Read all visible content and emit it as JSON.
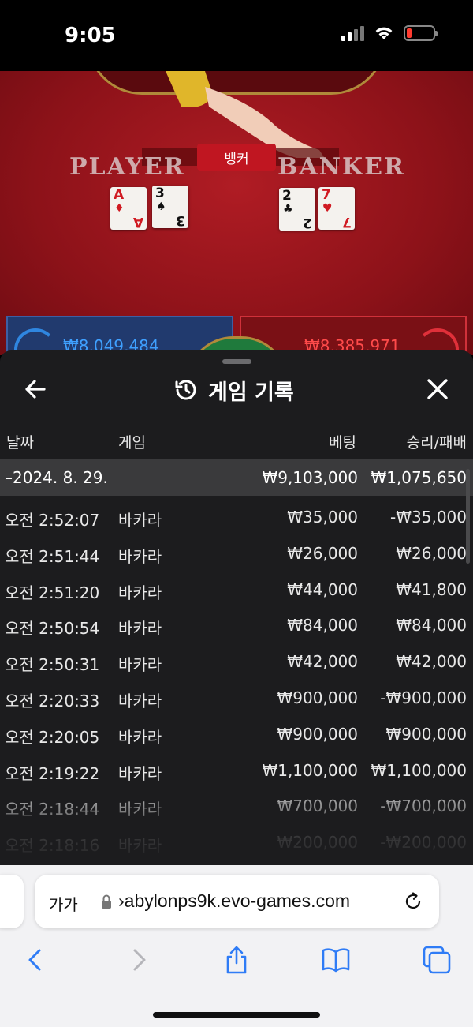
{
  "status_bar": {
    "time": "9:05"
  },
  "game": {
    "banner": "뱅커",
    "player_label": "PLAYER",
    "banker_label": "BANKER",
    "player_cards": [
      {
        "rank": "A",
        "suit": "♦",
        "color": "red"
      },
      {
        "rank": "3",
        "suit": "♠",
        "color": "black"
      }
    ],
    "banker_cards": [
      {
        "rank": "2",
        "suit": "♣",
        "color": "black"
      },
      {
        "rank": "7",
        "suit": "♥",
        "color": "red"
      }
    ],
    "player_total": "₩8,049,484",
    "banker_total": "₩8,385,971"
  },
  "history": {
    "title": "게임 기록",
    "columns": {
      "date": "날짜",
      "game": "게임",
      "bet": "베팅",
      "result": "승리/패배"
    },
    "date_group": {
      "date": "–2024. 8. 29.",
      "bet_total": "₩9,103,000",
      "result_total": "₩1,075,650"
    },
    "rows": [
      {
        "time": "오전 2:52:07",
        "game": "바카라",
        "bet": "₩35,000",
        "result": "-₩35,000"
      },
      {
        "time": "오전 2:51:44",
        "game": "바카라",
        "bet": "₩26,000",
        "result": "₩26,000"
      },
      {
        "time": "오전 2:51:20",
        "game": "바카라",
        "bet": "₩44,000",
        "result": "₩41,800"
      },
      {
        "time": "오전 2:50:54",
        "game": "바카라",
        "bet": "₩84,000",
        "result": "₩84,000"
      },
      {
        "time": "오전 2:50:31",
        "game": "바카라",
        "bet": "₩42,000",
        "result": "₩42,000"
      },
      {
        "time": "오전 2:20:33",
        "game": "바카라",
        "bet": "₩900,000",
        "result": "-₩900,000"
      },
      {
        "time": "오전 2:20:05",
        "game": "바카라",
        "bet": "₩900,000",
        "result": "₩900,000"
      },
      {
        "time": "오전 2:19:22",
        "game": "바카라",
        "bet": "₩1,100,000",
        "result": "₩1,100,000"
      },
      {
        "time": "오전 2:18:44",
        "game": "바카라",
        "bet": "₩700,000",
        "result": "-₩700,000"
      },
      {
        "time": "오전 2:18:16",
        "game": "바카라",
        "bet": "₩200,000",
        "result": "-₩200,000"
      }
    ]
  },
  "browser": {
    "text_size_label": "가가",
    "url": "›abylonps9k.evo-games.com"
  },
  "icons": {
    "back": "arrow-left-icon",
    "history": "history-clock-icon",
    "close": "close-icon",
    "lock": "lock-icon",
    "reload": "reload-icon",
    "nav_back": "chevron-left-icon",
    "nav_forward": "chevron-right-icon",
    "share": "share-icon",
    "bookmarks": "book-icon",
    "tabs": "tabs-icon"
  },
  "colors": {
    "accent_blue": "#2f7cf6",
    "loss_red": "#e0303a",
    "sheet_bg": "#1c1c1e"
  }
}
